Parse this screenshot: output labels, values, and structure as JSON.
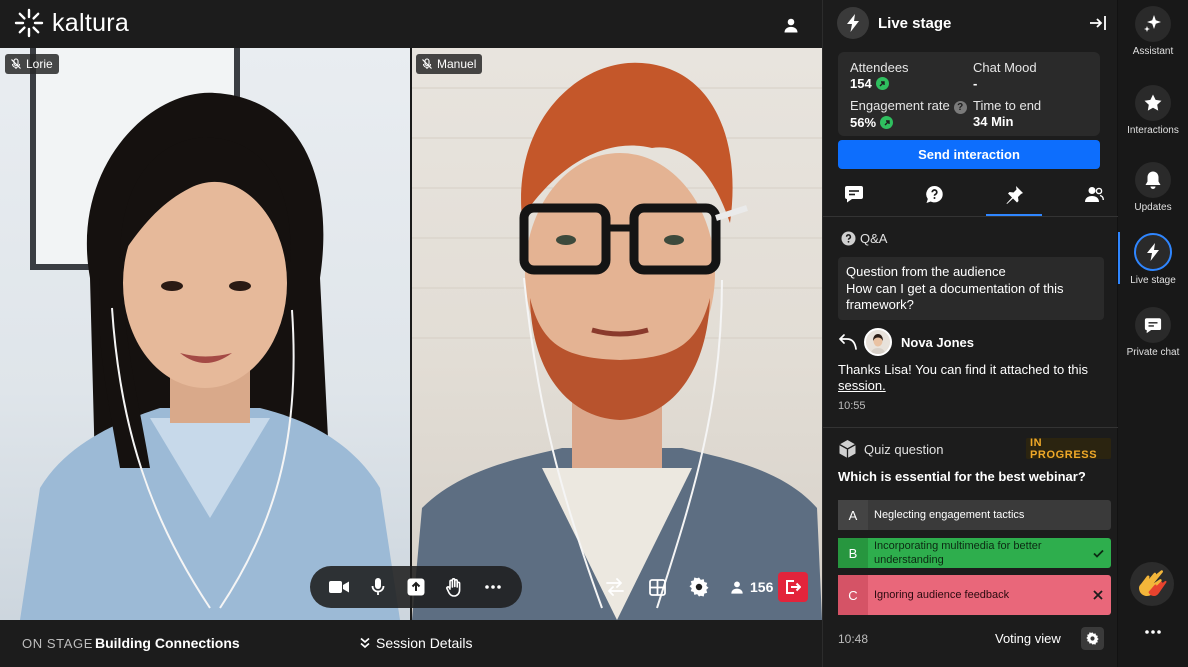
{
  "app": {
    "logo_text": "kaltura"
  },
  "tiles": [
    {
      "name": "Lorie"
    },
    {
      "name": "Manuel"
    }
  ],
  "controls": {
    "items": [
      "camera-icon",
      "microphone-icon",
      "share-screen-icon",
      "raise-hand-icon",
      "more-icon"
    ],
    "participant_count": "156"
  },
  "bottom": {
    "on_stage_label": "ON STAGE",
    "stage_title": "Building Connections",
    "session_details": "Session Details"
  },
  "panel": {
    "title": "Live stage",
    "stats": {
      "attendees_label": "Attendees",
      "attendees_value": "154",
      "chat_mood_label": "Chat Mood",
      "chat_mood_value": "-",
      "engagement_label": "Engagement rate",
      "engagement_value": "56%",
      "time_label": "Time to end",
      "time_value": "34 Min"
    },
    "send_button": "Send interaction",
    "qa": {
      "header": "Q&A",
      "question_title": "Question from the audience",
      "question_text": "How can I get a documentation of this framework?",
      "reply_name": "Nova Jones",
      "reply_text": "Thanks Lisa! You can find it attached to this",
      "reply_link": "session.",
      "reply_time": "10:55"
    },
    "quiz": {
      "header": "Quiz question",
      "status": "IN PROGRESS",
      "question": "Which is essential for the best webinar?",
      "options": [
        {
          "letter": "A",
          "text": "Neglecting engagement tactics"
        },
        {
          "letter": "B",
          "text": "Incorporating multimedia for better understanding"
        },
        {
          "letter": "C",
          "text": "Ignoring audience feedback"
        }
      ],
      "time": "10:48",
      "voting_view": "Voting view"
    }
  },
  "rail": {
    "items": [
      {
        "label": "Assistant"
      },
      {
        "label": "Interactions"
      },
      {
        "label": "Updates"
      },
      {
        "label": "Live stage"
      },
      {
        "label": "Private chat"
      }
    ]
  },
  "colors": {
    "accent_blue": "#0d6efd",
    "leave_red": "#e3243b",
    "correct_green": "#2eae4d",
    "wrong_red": "#e9677a",
    "status_orange": "#f0a928"
  }
}
